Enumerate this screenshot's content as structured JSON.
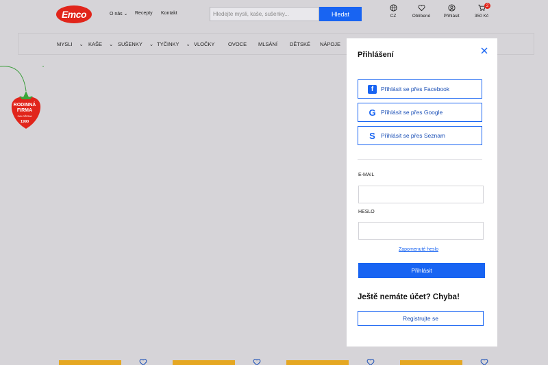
{
  "header": {
    "logo": "Emco",
    "nav": [
      "O nás",
      "Recepty",
      "Kontakt"
    ],
    "search_placeholder": "Hledejte mysli, kaše, sušenky...",
    "search_button": "Hledat",
    "lang": "CZ",
    "favorites": "Oblíbené",
    "login": "Přihlásit",
    "cart_count": "2",
    "cart_total": "350 Kč"
  },
  "categories": [
    "MYSLI",
    "KAŠE",
    "SUŠENKY",
    "TYČINKY",
    "VLOČKY",
    "OVOCE",
    "MLSÁNÍ",
    "DĚTSKÉ",
    "NÁPOJE"
  ],
  "badge": {
    "line1": "RODINNÁ",
    "line2": "FIRMA",
    "sub": "ZALOŽENA",
    "year": "1990"
  },
  "login_panel": {
    "title": "Přihlášení",
    "facebook": "Přihlásit se přes Facebook",
    "google": "Přihlásit se přes Google",
    "seznam": "Přihlásit se přes Seznam",
    "email_label": "E-MAIL",
    "password_label": "HESLO",
    "forgot": "Zapomenuté heslo",
    "submit": "Přihlásit",
    "no_account": "Ještě nemáte účet? Chyba!",
    "register": "Registrujte se"
  },
  "colors": {
    "brand_red": "#e1251b",
    "accent_blue": "#1864f2",
    "overlay_gray": "#d6d4d8"
  }
}
